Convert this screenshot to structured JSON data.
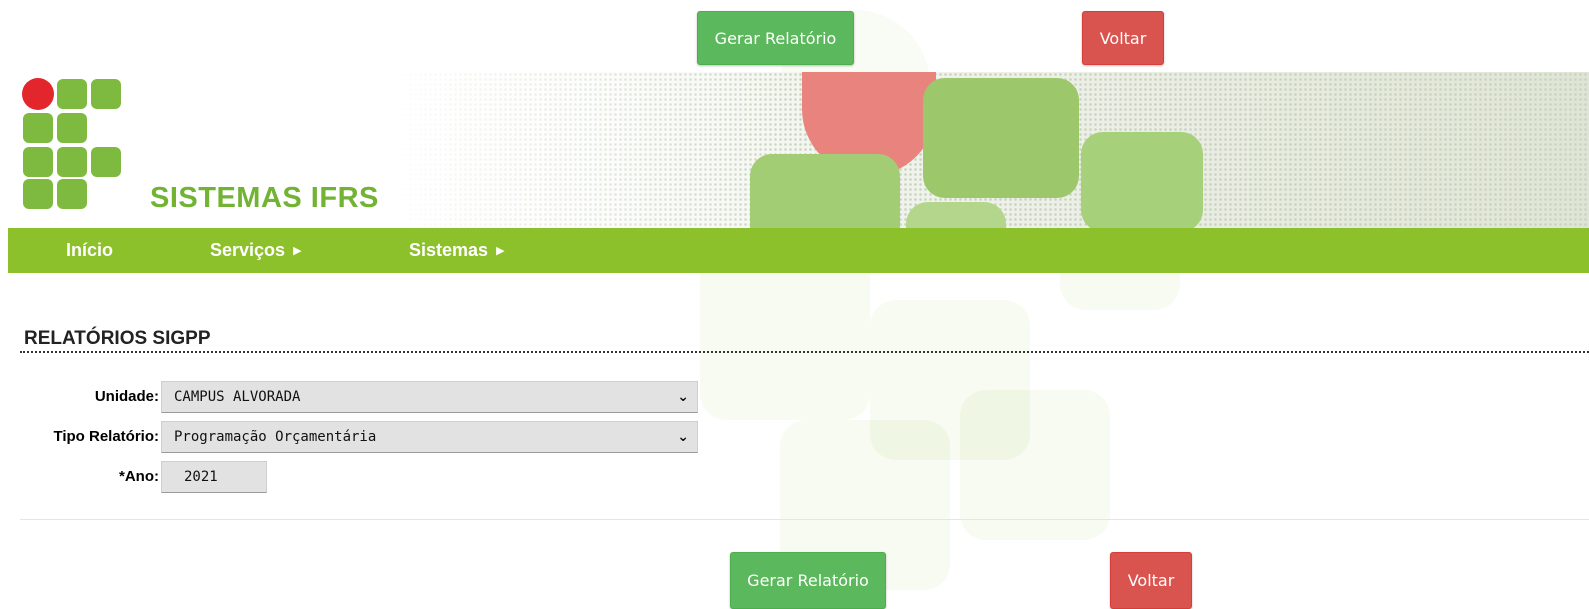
{
  "top_actions": {
    "generate_label": "Gerar Relatório",
    "back_label": "Voltar"
  },
  "header": {
    "logo_text": "SISTEMAS IFRS"
  },
  "nav": {
    "items": [
      {
        "label": "Início",
        "has_submenu": false
      },
      {
        "label": "Serviços",
        "has_submenu": true
      },
      {
        "label": "Sistemas",
        "has_submenu": true
      }
    ]
  },
  "page": {
    "title": "RELATÓRIOS SIGPP"
  },
  "form": {
    "unidade": {
      "label": "Unidade:",
      "value": "CAMPUS ALVORADA"
    },
    "tipo_relatorio": {
      "label": "Tipo Relatório:",
      "value": "Programação Orçamentária"
    },
    "ano": {
      "label": "*Ano:",
      "value": "2021"
    }
  },
  "bottom_actions": {
    "generate_label": "Gerar Relatório",
    "back_label": "Voltar"
  },
  "colors": {
    "nav_green": "#8dc12b",
    "button_green": "#5cb85c",
    "button_red": "#d9534f",
    "logo_green": "#72b334",
    "logo_red": "#e3262c"
  }
}
